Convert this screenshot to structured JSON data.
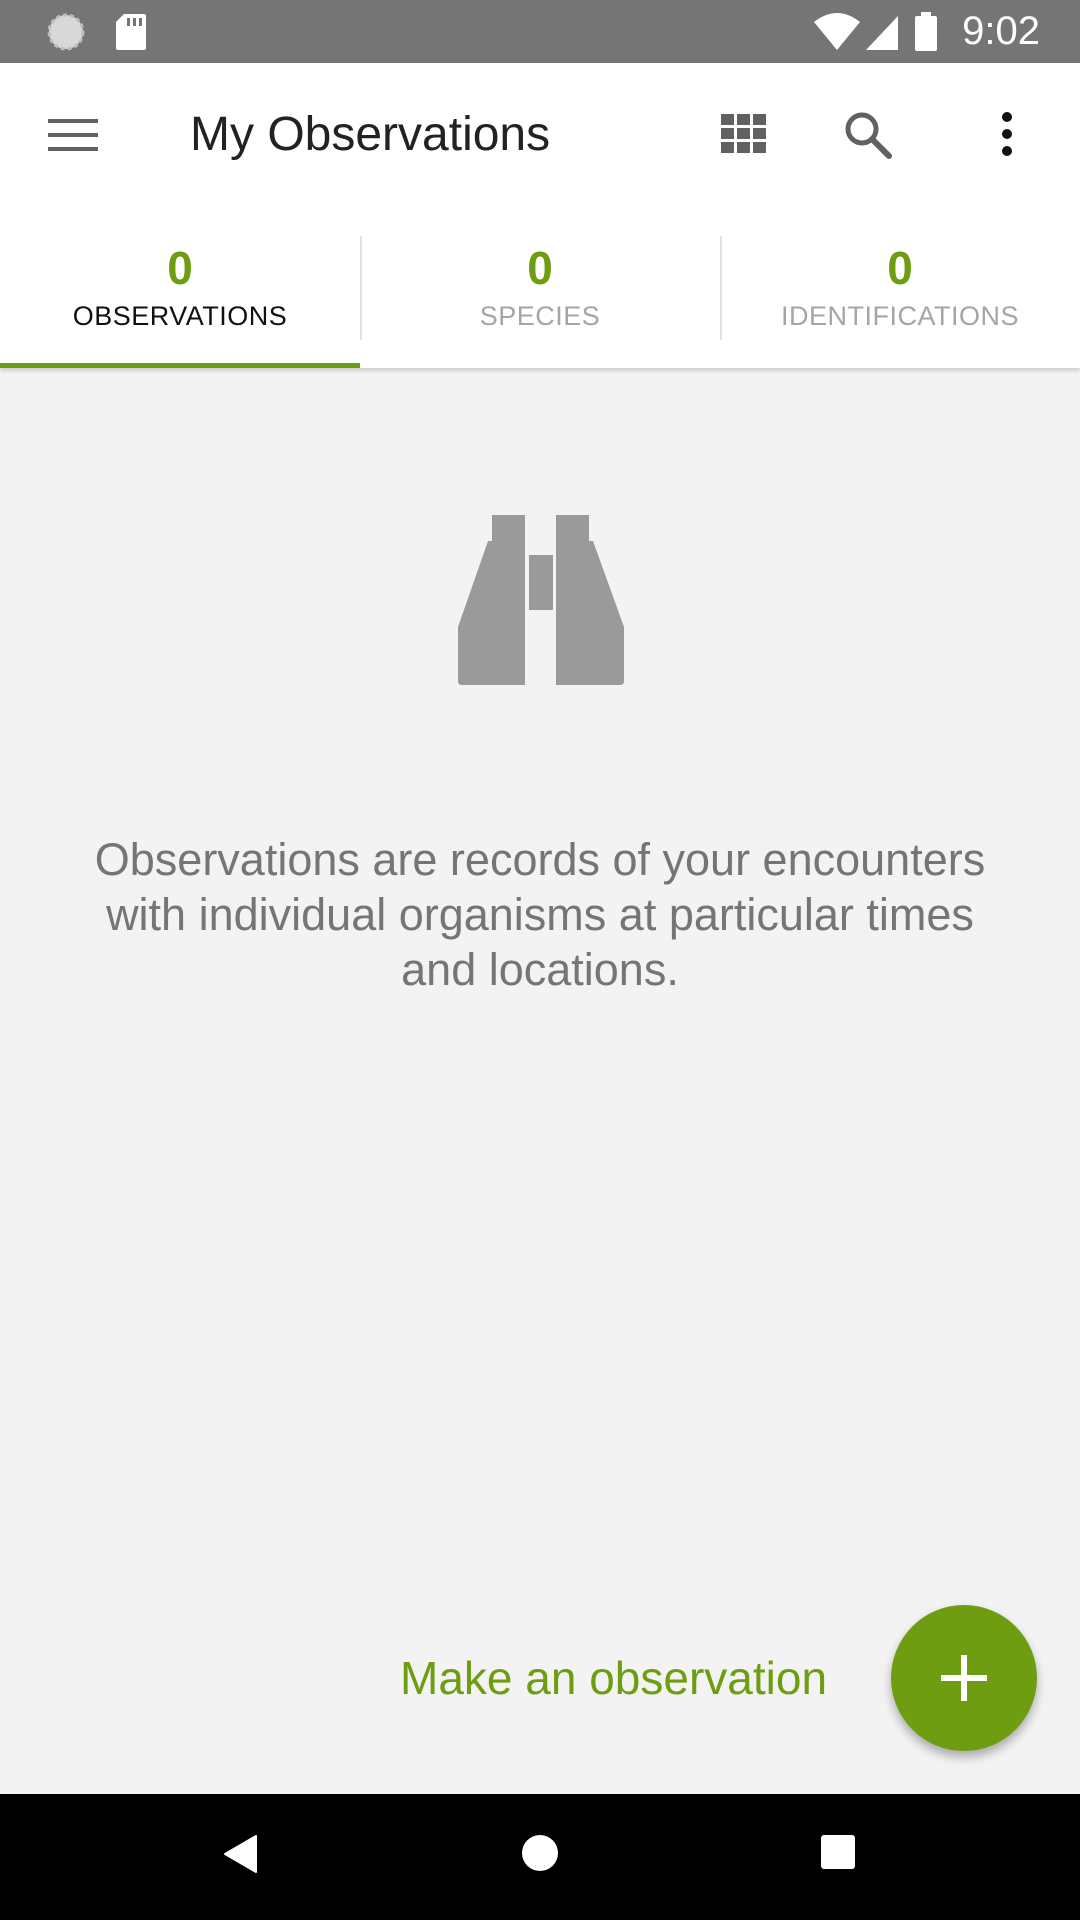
{
  "status_bar": {
    "time": "9:02",
    "left_icons": [
      "sync-icon",
      "sd-card-icon"
    ],
    "right_icons": [
      "wifi-icon",
      "signal-icon",
      "battery-icon"
    ]
  },
  "app_bar": {
    "title": "My Observations",
    "icons": [
      "menu-icon",
      "grid-view-icon",
      "search-icon",
      "more-vert-icon"
    ]
  },
  "tabs": [
    {
      "count": "0",
      "label": "OBSERVATIONS",
      "active": true
    },
    {
      "count": "0",
      "label": "SPECIES",
      "active": false
    },
    {
      "count": "0",
      "label": "IDENTIFICATIONS",
      "active": false
    }
  ],
  "empty_state": {
    "icon": "binoculars-icon",
    "message": "Observations are records of your encounters with individual organisms at particular times and locations."
  },
  "action": {
    "label": "Make an observation",
    "fab_icon": "plus-icon"
  },
  "nav_bar": {
    "icons": [
      "back-icon",
      "home-icon",
      "recents-icon"
    ]
  },
  "colors": {
    "accent": "#6e9d12",
    "status_bar": "#757575",
    "background": "#f3f3f3",
    "icon_gray": "#9a9a9a"
  }
}
